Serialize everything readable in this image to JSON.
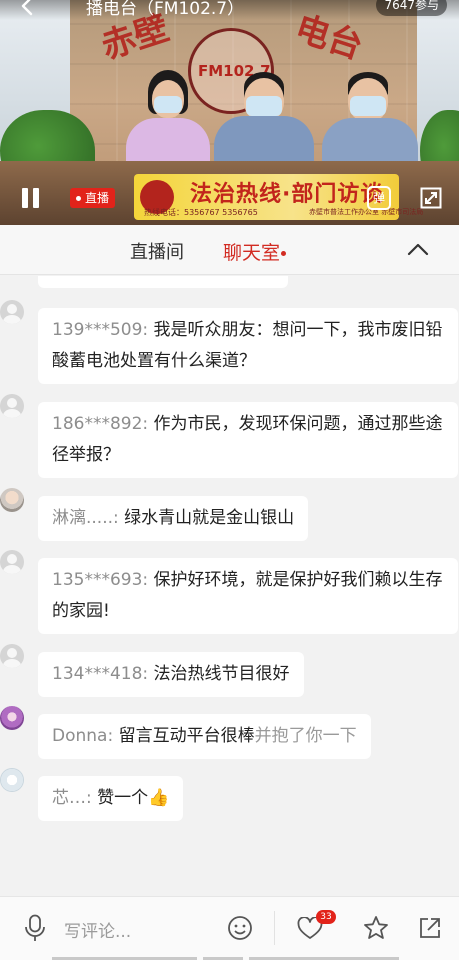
{
  "header": {
    "title": "播电台（FM102.7）",
    "viewers": "7647参与"
  },
  "video": {
    "backdrop_left": "赤壁",
    "backdrop_right": "电台",
    "logo_text": "FM102.7",
    "live_label": "直播",
    "banner_title": "法治热线·部门访谈",
    "banner_sub": "",
    "hotline": "热线电话：5356767  5356765",
    "host": "赤壁市普法工作办公室  赤壁市司法局",
    "danmu_label": "弹"
  },
  "tabs": {
    "live_room": "直播间",
    "chat_room": "聊天室"
  },
  "messages": [
    {
      "nick": "139***509:",
      "text": "我是听众朋友：想问一下，我市废旧铅酸蓄电池处置有什么渠道？",
      "extra": "",
      "avatar": "default-avatar-icon"
    },
    {
      "nick": "186***892:",
      "text": "作为市民，发现环保问题，通过那些途径举报？",
      "extra": "",
      "avatar": "default-avatar-icon"
    },
    {
      "nick": "淋漓.....:",
      "text": "绿水青山就是金山银山",
      "extra": "",
      "avatar": "photo-avatar"
    },
    {
      "nick": "135***693:",
      "text": "保护好环境，就是保护好我们赖以生存的家园!",
      "extra": "",
      "avatar": "default-avatar-icon"
    },
    {
      "nick": "134***418:",
      "text": "法治热线节目很好",
      "extra": "",
      "avatar": "default-avatar-icon"
    },
    {
      "nick": "Donna:",
      "text": "留言互动平台很棒",
      "extra": "并抱了你一下",
      "avatar": "photo-avatar"
    },
    {
      "nick": "芯…:",
      "text": "赞一个👍",
      "extra": "",
      "avatar": "photo-avatar"
    }
  ],
  "bottom": {
    "comment_placeholder": "写评论...",
    "like_count": "33"
  },
  "colors": {
    "accent_red": "#d22b22",
    "live_red": "#e2231a",
    "nick_gray": "#8d8d8d"
  }
}
